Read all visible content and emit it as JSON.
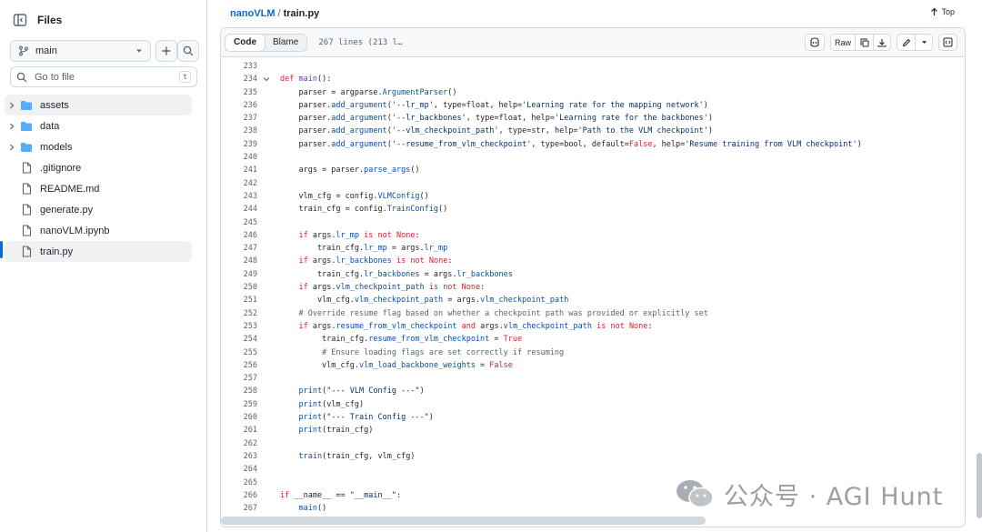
{
  "sidebar": {
    "title": "Files",
    "branch": "main",
    "search_placeholder": "Go to file",
    "search_key": "t",
    "items": [
      {
        "label": "assets",
        "type": "folder"
      },
      {
        "label": "data",
        "type": "folder"
      },
      {
        "label": "models",
        "type": "folder"
      },
      {
        "label": ".gitignore",
        "type": "file"
      },
      {
        "label": "README.md",
        "type": "file"
      },
      {
        "label": "generate.py",
        "type": "file"
      },
      {
        "label": "nanoVLM.ipynb",
        "type": "file"
      },
      {
        "label": "train.py",
        "type": "file"
      }
    ]
  },
  "header": {
    "repo": "nanoVLM",
    "separator": "/",
    "file": "train.py",
    "top_label": "Top"
  },
  "file_header": {
    "code_tab": "Code",
    "blame_tab": "Blame",
    "lines_info": "267 lines (213 l…",
    "raw_label": "Raw"
  },
  "code_lines": [
    {
      "n": "233",
      "t": ""
    },
    {
      "n": "234",
      "t": "def main():"
    },
    {
      "n": "235",
      "t": "    parser = argparse.ArgumentParser()"
    },
    {
      "n": "236",
      "t": "    parser.add_argument('--lr_mp', type=float, help='Learning rate for the mapping network')"
    },
    {
      "n": "237",
      "t": "    parser.add_argument('--lr_backbones', type=float, help='Learning rate for the backbones')"
    },
    {
      "n": "238",
      "t": "    parser.add_argument('--vlm_checkpoint_path', type=str, help='Path to the VLM checkpoint')"
    },
    {
      "n": "239",
      "t": "    parser.add_argument('--resume_from_vlm_checkpoint', type=bool, default=False, help='Resume training from VLM checkpoint')"
    },
    {
      "n": "240",
      "t": ""
    },
    {
      "n": "241",
      "t": "    args = parser.parse_args()"
    },
    {
      "n": "242",
      "t": ""
    },
    {
      "n": "243",
      "t": "    vlm_cfg = config.VLMConfig()"
    },
    {
      "n": "244",
      "t": "    train_cfg = config.TrainConfig()"
    },
    {
      "n": "245",
      "t": ""
    },
    {
      "n": "246",
      "t": "    if args.lr_mp is not None:"
    },
    {
      "n": "247",
      "t": "        train_cfg.lr_mp = args.lr_mp"
    },
    {
      "n": "248",
      "t": "    if args.lr_backbones is not None:"
    },
    {
      "n": "249",
      "t": "        train_cfg.lr_backbones = args.lr_backbones"
    },
    {
      "n": "250",
      "t": "    if args.vlm_checkpoint_path is not None:"
    },
    {
      "n": "251",
      "t": "        vlm_cfg.vlm_checkpoint_path = args.vlm_checkpoint_path"
    },
    {
      "n": "252",
      "t": "    # Override resume flag based on whether a checkpoint path was provided or explicitly set"
    },
    {
      "n": "253",
      "t": "    if args.resume_from_vlm_checkpoint and args.vlm_checkpoint_path is not None:"
    },
    {
      "n": "254",
      "t": "         train_cfg.resume_from_vlm_checkpoint = True"
    },
    {
      "n": "255",
      "t": "         # Ensure loading flags are set correctly if resuming"
    },
    {
      "n": "256",
      "t": "         vlm_cfg.vlm_load_backbone_weights = False"
    },
    {
      "n": "257",
      "t": ""
    },
    {
      "n": "258",
      "t": "    print(\"--- VLM Config ---\")"
    },
    {
      "n": "259",
      "t": "    print(vlm_cfg)"
    },
    {
      "n": "260",
      "t": "    print(\"--- Train Config ---\")"
    },
    {
      "n": "261",
      "t": "    print(train_cfg)"
    },
    {
      "n": "262",
      "t": ""
    },
    {
      "n": "263",
      "t": "    train(train_cfg, vlm_cfg)"
    },
    {
      "n": "264",
      "t": ""
    },
    {
      "n": "265",
      "t": ""
    },
    {
      "n": "266",
      "t": "if __name__ == \"__main__\":"
    },
    {
      "n": "267",
      "t": "    main()"
    }
  ],
  "watermark": {
    "text": "公众号 · AGI Hunt"
  },
  "colors": {
    "accent": "#0969da",
    "folder": "#54aeff",
    "keyword": "#cf222e",
    "function": "#6639ba",
    "string": "#0a3069"
  }
}
